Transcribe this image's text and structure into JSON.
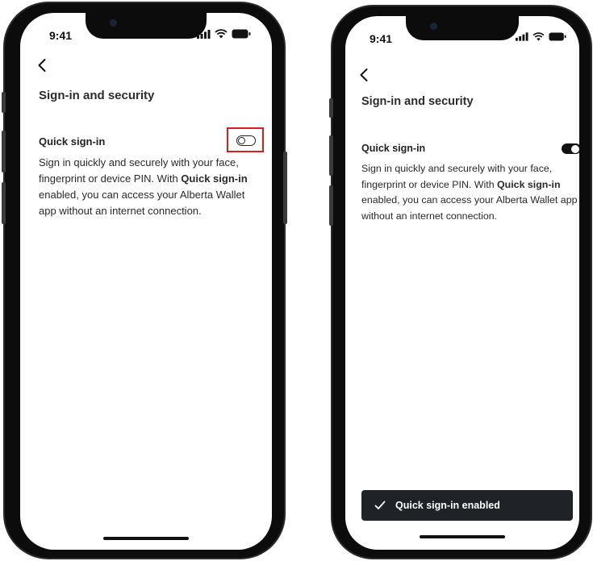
{
  "screens": [
    {
      "status_time": "9:41",
      "page_title": "Sign-in and security",
      "section_label": "Quick sign-in",
      "desc_part1": "Sign in quickly and securely with your face, fingerprint or device PIN. With ",
      "desc_bold": "Quick sign-in",
      "desc_part2": " enabled, you can access your Alberta Wallet app without an internet connection.",
      "toggle_state": "off"
    },
    {
      "status_time": "9:41",
      "page_title": "Sign-in and security",
      "section_label": "Quick sign-in",
      "desc_part1": "Sign in quickly and securely with your face, fingerprint or device PIN. With ",
      "desc_bold": "Quick sign-in",
      "desc_part2": " enabled, you can access your Alberta Wallet app without an internet connection.",
      "toggle_state": "on",
      "toast_text": "Quick sign-in enabled"
    }
  ],
  "icons": {
    "back": "chevron-left-icon",
    "signal": "cellular-signal-icon",
    "wifi": "wifi-icon",
    "battery": "battery-icon",
    "toast_check": "checkmark-icon"
  },
  "colors": {
    "highlight": "#d32020",
    "toast_bg": "#1f2227",
    "toggle_on": "#111111"
  }
}
